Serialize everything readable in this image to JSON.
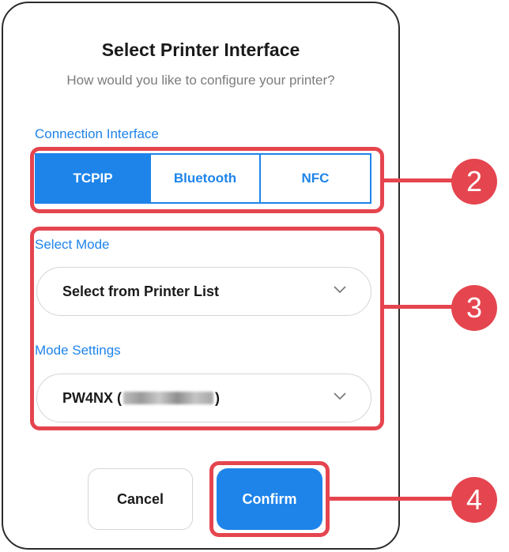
{
  "dialog": {
    "title": "Select Printer Interface",
    "subtitle": "How would you like to configure your printer?"
  },
  "connection_interface": {
    "label": "Connection Interface",
    "options": [
      "TCPIP",
      "Bluetooth",
      "NFC"
    ],
    "selected": "TCPIP"
  },
  "select_mode": {
    "label": "Select Mode",
    "value": "Select from Printer List"
  },
  "mode_settings": {
    "label": "Mode Settings",
    "value_prefix": "PW4NX (",
    "value_suffix": ")"
  },
  "buttons": {
    "cancel": "Cancel",
    "confirm": "Confirm"
  },
  "callouts": [
    "2",
    "3",
    "4"
  ],
  "colors": {
    "accent": "#1e84ea",
    "highlight": "#e5454f"
  }
}
